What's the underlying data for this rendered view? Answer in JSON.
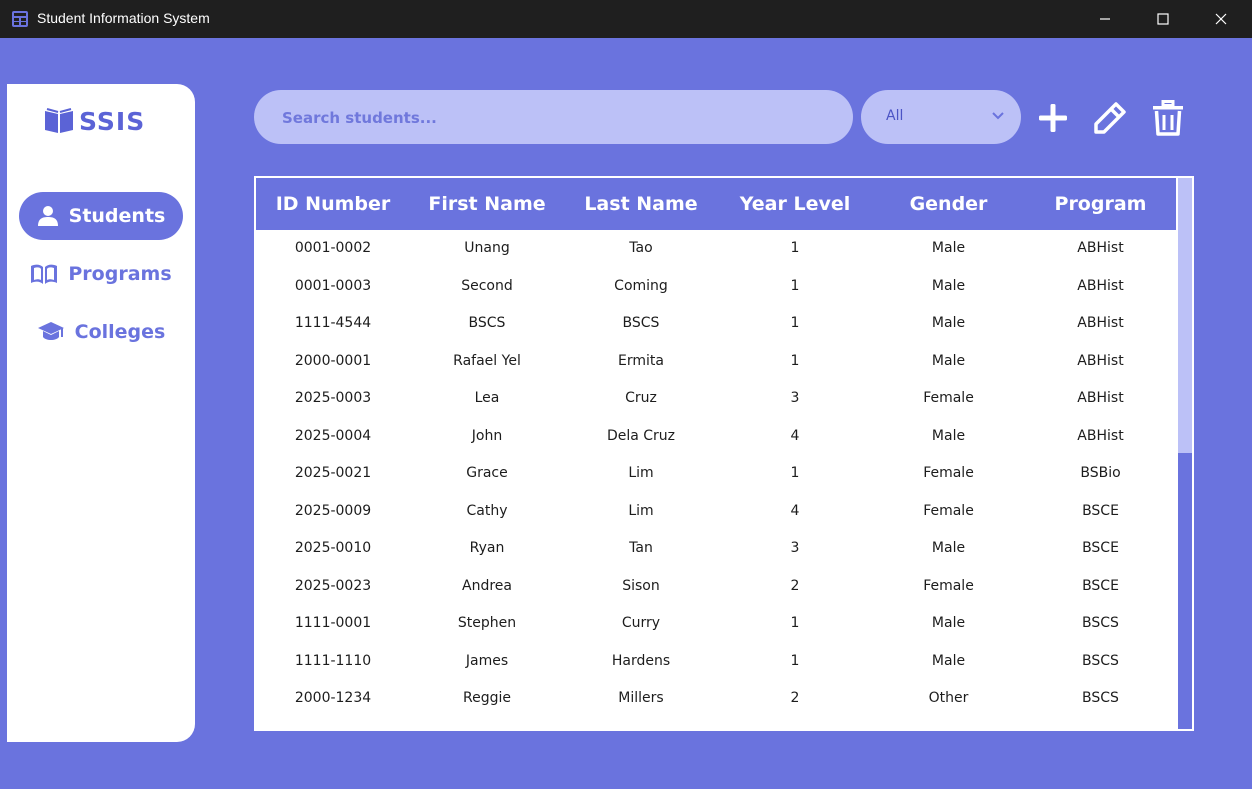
{
  "window": {
    "title": "Student Information System",
    "icon": "grid-app-icon",
    "controls": [
      "minimize-icon",
      "maximize-icon",
      "close-icon"
    ]
  },
  "sidebar": {
    "logo_text": "SSIS",
    "logo_icon": "open-book-icon",
    "items": [
      {
        "label": "Students",
        "icon": "person-icon",
        "active": true
      },
      {
        "label": "Programs",
        "icon": "book-icon",
        "active": false
      },
      {
        "label": "Colleges",
        "icon": "graduation-cap-icon",
        "active": false
      }
    ]
  },
  "toolbar": {
    "search_placeholder": "Search students...",
    "search_value": "",
    "filter_value": "All",
    "actions": [
      "add-icon",
      "edit-pencil-icon",
      "delete-trash-icon"
    ]
  },
  "table": {
    "columns": [
      "ID Number",
      "First Name",
      "Last Name",
      "Year Level",
      "Gender",
      "Program"
    ],
    "rows": [
      [
        "0001-0002",
        "Unang",
        "Tao",
        "1",
        "Male",
        "ABHist"
      ],
      [
        "0001-0003",
        "Second",
        "Coming",
        "1",
        "Male",
        "ABHist"
      ],
      [
        "1111-4544",
        "BSCS",
        "BSCS",
        "1",
        "Male",
        "ABHist"
      ],
      [
        "2000-0001",
        "Rafael Yel",
        "Ermita",
        "1",
        "Male",
        "ABHist"
      ],
      [
        "2025-0003",
        "Lea",
        "Cruz",
        "3",
        "Female",
        "ABHist"
      ],
      [
        "2025-0004",
        "John",
        "Dela Cruz",
        "4",
        "Male",
        "ABHist"
      ],
      [
        "2025-0021",
        "Grace",
        "Lim",
        "1",
        "Female",
        "BSBio"
      ],
      [
        "2025-0009",
        "Cathy",
        "Lim",
        "4",
        "Female",
        "BSCE"
      ],
      [
        "2025-0010",
        "Ryan",
        "Tan",
        "3",
        "Male",
        "BSCE"
      ],
      [
        "2025-0023",
        "Andrea",
        "Sison",
        "2",
        "Female",
        "BSCE"
      ],
      [
        "1111-0001",
        "Stephen",
        "Curry",
        "1",
        "Male",
        "BSCS"
      ],
      [
        "1111-1110",
        "James",
        "Hardens",
        "1",
        "Male",
        "BSCS"
      ],
      [
        "2000-1234",
        "Reggie",
        "Millers",
        "2",
        "Other",
        "BSCS"
      ]
    ],
    "scroll_position": 0.0
  },
  "colors": {
    "background": "#6a73de",
    "accent_light": "#bcc1f7",
    "titlebar": "#1f1f1f",
    "panel": "#ffffff"
  }
}
